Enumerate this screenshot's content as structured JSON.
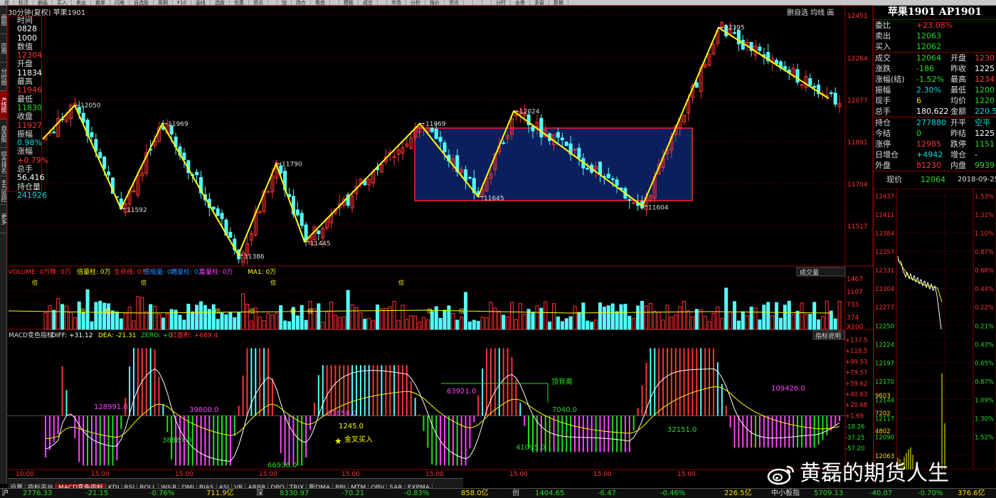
{
  "toolbar": [
    "综",
    "标注",
    "删画",
    "买入",
    "卖出",
    "撤单",
    "闪电",
    "自选股",
    "周期",
    "F10",
    "画线",
    "选股",
    "优惠",
    "资讯",
    "",
    "加",
    "持仓",
    "看盘",
    "",
    "模板",
    "成交",
    "",
    "市场",
    "分析",
    "报价",
    "资讯",
    "",
    "",
    "",
    "分时",
    "全景",
    "多窗",
    "数据"
  ],
  "sidebar": [
    "画图",
    "应用",
    "分时图",
    "K线图",
    "自选股",
    "综合排名",
    "主力监控",
    "更多"
  ],
  "sidebar_active": 3,
  "title_bar": "30分钟(复权)  苹果1901",
  "top_right": "删自选  均线  画",
  "left_panel": [
    {
      "label": "时间",
      "value": ""
    },
    {
      "label": "",
      "value": "0828",
      "color": "#ffffff"
    },
    {
      "label": "",
      "value": "1000",
      "color": "#ffffff"
    },
    {
      "label": "数值",
      "value": ""
    },
    {
      "label": "",
      "value": "12304",
      "color": "#ff3333"
    },
    {
      "label": "开盘",
      "value": ""
    },
    {
      "label": "",
      "value": "11834",
      "color": "#ffffff"
    },
    {
      "label": "最高",
      "value": ""
    },
    {
      "label": "",
      "value": "11946",
      "color": "#ff3333"
    },
    {
      "label": "最低",
      "value": ""
    },
    {
      "label": "",
      "value": "11830",
      "color": "#22dd22"
    },
    {
      "label": "收盘",
      "value": ""
    },
    {
      "label": "",
      "value": "11927",
      "color": "#ff3333"
    },
    {
      "label": "振幅",
      "value": ""
    },
    {
      "label": "",
      "value": "0.98%",
      "color": "#00dddd"
    },
    {
      "label": "涨幅",
      "value": ""
    },
    {
      "label": "",
      "value": "+0.79%",
      "color": "#ff3333"
    },
    {
      "label": "总手",
      "value": ""
    },
    {
      "label": "",
      "value": "56,416",
      "color": "#ffffff"
    },
    {
      "label": "持仓量",
      "value": ""
    },
    {
      "label": "",
      "value": "241926",
      "color": "#00dddd"
    }
  ],
  "price_axis": [
    "12451",
    "12264",
    "12077",
    "11891",
    "11704",
    "11517"
  ],
  "volume_axis": [
    "1467",
    "1107",
    "733",
    "374",
    "X100"
  ],
  "macd_axis": [
    "+137.5",
    "+118.5",
    "+99.53",
    "+79.57",
    "+59.62",
    "+40.63",
    "+20.68",
    "+1.69",
    "-18.26",
    "-37.25",
    "-57.20"
  ],
  "time_axis": [
    "10:00",
    "15.00",
    "15.00",
    "15.00",
    "15.00",
    "15.00",
    "15.00",
    "15.00",
    "15.00"
  ],
  "swing_labels": [
    "12050",
    "11592",
    "11969",
    "11386",
    "11790",
    "11445",
    "11969",
    "11645",
    "12024",
    "11604",
    "12395"
  ],
  "volume_header": {
    "vol": "VOLUME: 0万",
    "jiang": "降: 0万",
    "bei": "倍量柱: 0万",
    "sheng": "生命线: 0万",
    "bai": "倍缩量: 0万",
    "di": "地量柱: 0万",
    "gao": "高量柱: 0万",
    "ma": "MA1: 0万",
    "button": "成交量"
  },
  "macd_header": {
    "name": "MACD变色指标",
    "diff": "DIFF: +31.12",
    "dea": "DEA: -21.31",
    "zero": "ZERO: +0",
    "hong": "红面积: +669.4",
    "button": "指标说明"
  },
  "macd_labels": [
    "128991.0",
    "39800.0",
    "38887.0",
    "21858.0",
    "1245.0",
    "66936.0",
    "63921.0",
    "顶背离",
    "7040.0",
    "41095.0",
    "32151.0",
    "109426.0",
    "金叉买入"
  ],
  "volume_markers": [
    "倍",
    "倍",
    "倍",
    "倍",
    "倍",
    "倍",
    "倍",
    "倍",
    "倍",
    "倍",
    "倍",
    "倍"
  ],
  "right_panel": {
    "title": "苹果1901 AP1901",
    "rows1": [
      {
        "l": "委比",
        "v": "+23.08%",
        "vc": "#ff3333"
      },
      {
        "l": "卖出",
        "v": "12063",
        "vc": "#22dd22"
      },
      {
        "l": "买入",
        "v": "12062",
        "vc": "#22dd22"
      }
    ],
    "rows2": [
      {
        "l": "成交",
        "v": "12064",
        "vc": "#22dd22",
        "l2": "开盘",
        "v2": "1230",
        "v2c": "#ff3333"
      },
      {
        "l": "涨跌",
        "v": "-186",
        "vc": "#22dd22",
        "l2": "昨收",
        "v2": "1225",
        "v2c": "#ffffff"
      },
      {
        "l": "涨幅(结)",
        "v": "-1.52%",
        "vc": "#22dd22",
        "l2": "最高",
        "v2": "1234",
        "v2c": "#ff3333"
      },
      {
        "l": "振幅",
        "v": "2.30%",
        "vc": "#00dddd",
        "l2": "最低",
        "v2": "1200",
        "v2c": "#22dd22"
      },
      {
        "l": "现手",
        "v": "6",
        "vc": "#ffdd00",
        "l2": "均价",
        "v2": "1220",
        "v2c": "#22dd22"
      },
      {
        "l": "总手",
        "v": "180,622",
        "vc": "#ffffff",
        "l2": "金额",
        "v2": "220.5",
        "v2c": "#00dddd"
      }
    ],
    "rows3": [
      {
        "l": "持仓",
        "v": "277880",
        "vc": "#00dddd",
        "l2": "开平",
        "v2": "空平",
        "v2c": "#00dddd"
      },
      {
        "l": "今结",
        "v": "0",
        "vc": "#22dd22",
        "l2": "昨结",
        "v2": "1225",
        "v2c": "#ffffff"
      },
      {
        "l": "涨停",
        "v": "12985",
        "vc": "#ff3333",
        "l2": "跌停",
        "v2": "1151",
        "v2c": "#22dd22"
      },
      {
        "l": "日增仓",
        "v": "+4942",
        "vc": "#00dddd",
        "l2": "增仓",
        "v2": "-",
        "v2c": "#ffffff"
      },
      {
        "l": "外盘",
        "v": "81230",
        "vc": "#ff3333",
        "l2": "内盘",
        "v2": "9939",
        "v2c": "#22dd22"
      }
    ],
    "now_label": "现价",
    "now_val": "12064",
    "now_time": "2018-09-25,",
    "mini_left": [
      "12437",
      "12411",
      "12384",
      "12357",
      "12331",
      "12304",
      "12277",
      "12250",
      "12224",
      "12197",
      "12170",
      "12144",
      "12117",
      "12090",
      "12063",
      "9603",
      "7202",
      "4802"
    ],
    "mini_right": [
      "1.53%",
      "1.31%",
      "1.10%",
      "0.87%",
      "0.66%",
      "0.44%",
      "0.22%",
      "0.21%",
      "0.43%",
      "0.65%",
      "0.87%",
      "1.09%",
      "1.30%",
      "1.52%"
    ]
  },
  "tabs": [
    "设置",
    "指标平台",
    "MACD变色指标",
    "KDJ",
    "RSI",
    "BOLL",
    "W&R",
    "DMI",
    "BIAS",
    "ASI",
    "VR",
    "ARBR",
    "DPO",
    "TRIX",
    "新DMA",
    "BBI",
    "MTM",
    "OBV",
    "SAR",
    "EXPMA"
  ],
  "tabs_active": 2,
  "status": [
    {
      "t": "沪",
      "c": "#dddddd"
    },
    {
      "t": "2776.33",
      "c": "#22dd22"
    },
    {
      "t": "-21.15",
      "c": "#22dd22"
    },
    {
      "t": "-0.76%",
      "c": "#22dd22"
    },
    {
      "t": "711.9亿",
      "c": "#ffdd00"
    },
    {
      "t": "深",
      "c": "#dddddd"
    },
    {
      "t": "8330.97",
      "c": "#22dd22"
    },
    {
      "t": "-70.21",
      "c": "#22dd22"
    },
    {
      "t": "-0.83%",
      "c": "#22dd22"
    },
    {
      "t": "858.0亿",
      "c": "#ffdd00"
    },
    {
      "t": "创",
      "c": "#dddddd"
    },
    {
      "t": "1404.65",
      "c": "#22dd22"
    },
    {
      "t": "-6.47",
      "c": "#22dd22"
    },
    {
      "t": "-0.46%",
      "c": "#22dd22"
    },
    {
      "t": "226.5亿",
      "c": "#ffdd00"
    },
    {
      "t": "中小板指",
      "c": "#dddddd"
    },
    {
      "t": "5709.13",
      "c": "#22dd22"
    },
    {
      "t": "-40.07",
      "c": "#22dd22"
    },
    {
      "t": "-0.70%",
      "c": "#22dd22"
    },
    {
      "t": "376.6亿",
      "c": "#ffdd00"
    }
  ],
  "watermark": "黄磊的期货人生",
  "colors": {
    "up": "#ff3333",
    "down": "#54ffff",
    "grid": "#8b0000",
    "zigzag": "#ffff00",
    "box": "#0a1f5c"
  }
}
